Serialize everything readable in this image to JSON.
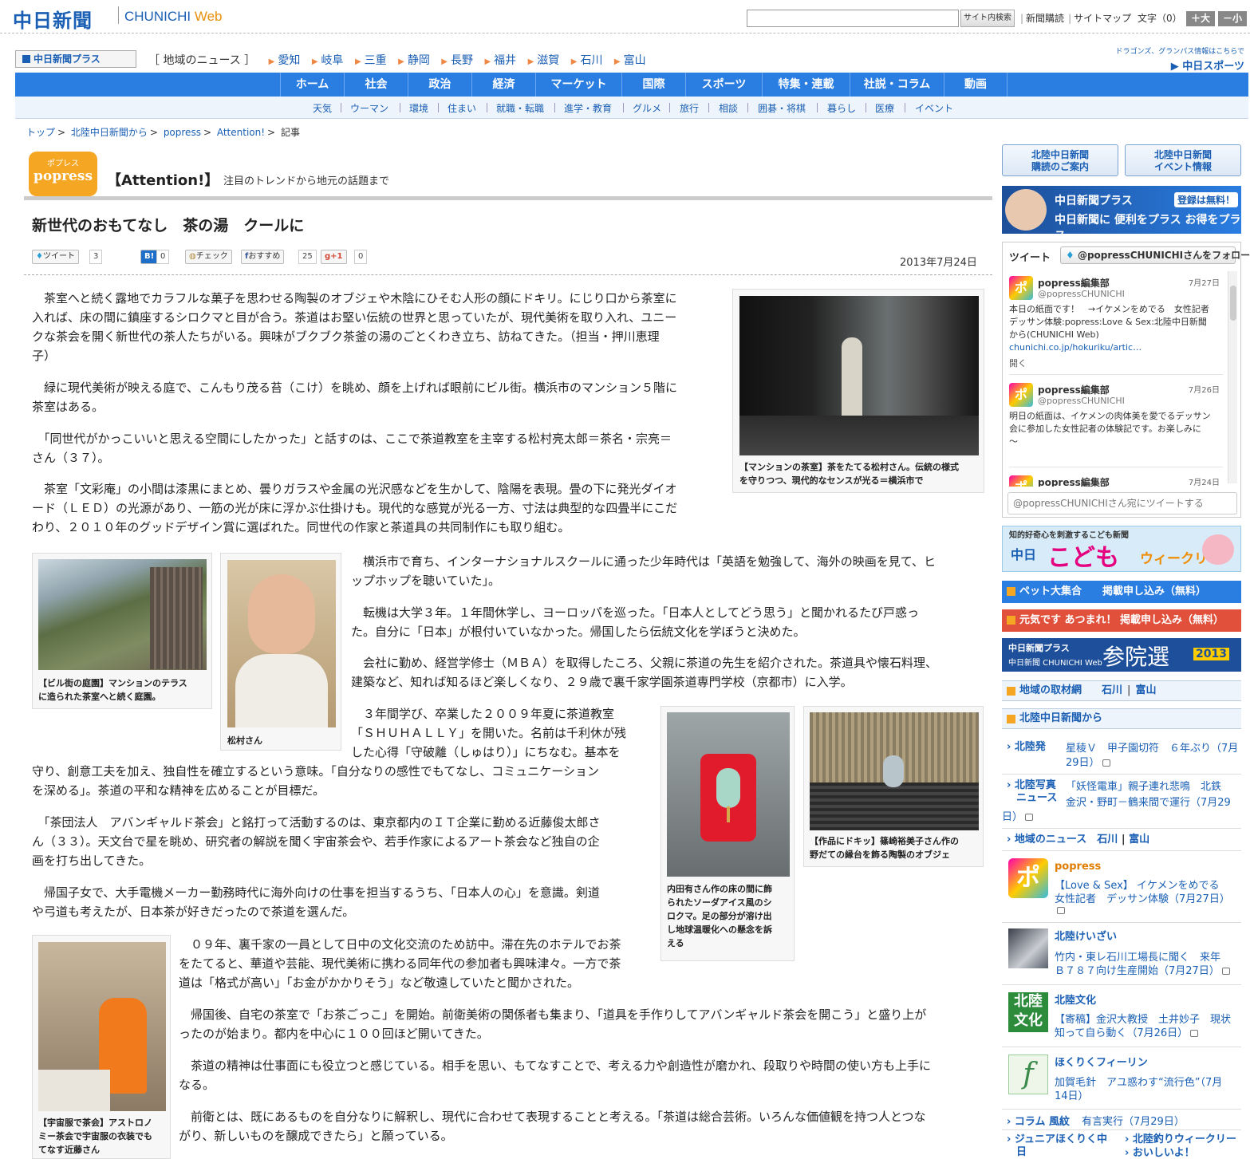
{
  "header": {
    "logo": "中日新聞",
    "logo_sub_a": "CHUNICHI ",
    "logo_sub_b": "Web",
    "search_placeholder": "",
    "search_button": "サイト内検索",
    "link_subscribe": "新聞購読",
    "link_sitemap": "サイトマップ",
    "text_size_label": "文字（0）",
    "size_up": "＋大",
    "size_down": "－小"
  },
  "plus_bar": {
    "logo": "中日新聞プラス",
    "region_label": "［ 地域のニュース ］",
    "regions": [
      "愛知",
      "岐阜",
      "三重",
      "静岡",
      "長野",
      "福井",
      "滋賀",
      "石川",
      "富山"
    ],
    "dragons_note_1": "ドラゴンズ、グランパス情報はこちらで",
    "sports_link": "中日スポーツ"
  },
  "main_nav": [
    "ホーム",
    "社会",
    "政治",
    "経済",
    "マーケット",
    "国際",
    "スポーツ",
    "特集・連載",
    "社説・コラム",
    "動画"
  ],
  "sub_nav": [
    "天気",
    "ウーマン",
    "環境",
    "住まい",
    "就職・転職",
    "進学・教育",
    "グルメ",
    "旅行",
    "相談",
    "囲碁・将棋",
    "暮らし",
    "医療",
    "イベント"
  ],
  "breadcrumb": [
    "トップ",
    "北陸中日新聞から",
    "popress",
    "Attention!",
    "記事"
  ],
  "section": {
    "logo_kana": "ポプレス",
    "logo_name": "popress",
    "title": "【Attention!】",
    "desc": "注目のトレンドから地元の話題まで"
  },
  "article": {
    "title": "新世代のおもてなし　茶の湯　クールに",
    "date": "2013年7月24日",
    "social": {
      "tweet": "ツイート",
      "tweet_count": "3",
      "hatena_count": "0",
      "check": "チェック",
      "fb": "おすすめ",
      "fb_count": "25",
      "gplus": "+1",
      "gplus_count": "0"
    },
    "p1": [
      "　茶室へと続く露地でカラフルな菓子を思わせる陶製のオブジェや木陰にひそむ人形の顔にドキリ。にじり口から茶室に",
      "入れば、床の間に鎮座するシロクマと目が合う。茶道はお堅い伝統の世界と思っていたが、現代美術を取り入れ、ユニー",
      "クな茶会を開く新世代の茶人たちがいる。興味がブクブク茶釜の湯のごとくわき立ち、訪ねてきた。（担当・押川恵理",
      "子）"
    ],
    "p2": [
      "　緑に現代美術が映える庭で、こんもり茂る苔（こけ）を眺め、顔を上げれば眼前にビル街。横浜市のマンション５階に",
      "茶室はある。"
    ],
    "p3": [
      "　「同世代がかっこいいと思える空間にしたかった」と話すのは、ここで茶道教室を主宰する松村亮太郎＝茶名・宗亮＝",
      "さん（３７）。"
    ],
    "p4": [
      "　茶室「文彩庵」の小間は漆黒にまとめ、曇りガラスや金属の光沢感などを生かして、陰陽を表現。畳の下に発光ダイオ",
      "ード（ＬＥＤ）の光源があり、一筋の光が床に浮かぶ仕掛けも。現代的な感覚が光る一方、寸法は典型的な四畳半にこだ",
      "わり、２０１０年のグッドデザイン賞に選ばれた。同世代の作家と茶道具の共同制作にも取り組む。"
    ],
    "p5": [
      "　横浜市で育ち、インターナショナルスクールに通った少年時代は「英語を勉強して、海外の映画を見て、ヒ",
      "ップホップを聴いていた」。"
    ],
    "p6": [
      "　転機は大学３年。１年間休学し、ヨーロッパを巡った。「日本人としてどう思う」と聞かれるたび戸惑っ",
      "た。自分に「日本」が根付いていなかった。帰国したら伝統文化を学ぼうと決めた。"
    ],
    "p7": [
      "　会社に勤め、経営学修士（ＭＢＡ）を取得したころ、父親に茶道の先生を紹介された。茶道具や懐石料理、",
      "建築など、知れば知るほど楽しくなり、２９歳で裏千家学園茶道専門学校（京都市）に入学。"
    ],
    "p8a": [
      "　３年間学び、卒業した２００９年夏に茶道教室",
      "「ＳＨＵＨＡＬＬＹ」を開いた。名前は千利休が残",
      "した心得「守破離（しゅはり）」にちなむ。基本を"
    ],
    "p8b": [
      "守り、創意工夫を加え、独自性を確立するという意味。「自分なりの感性でもてなし、コミュニケーション",
      "を深める」。茶道の平和な精神を広めることが目標だ。"
    ],
    "p9": [
      "　「茶団法人　アバンギャルド茶会」と銘打って活動するのは、東京都内のＩＴ企業に勤める近藤俊太郎さ",
      "ん（３３）。天文台で星を眺め、研究者の解説を聞く宇宙茶会や、若手作家によるアート茶会など独自の企",
      "画を打ち出してきた。"
    ],
    "p10": [
      "　帰国子女で、大手電機メーカー勤務時代に海外向けの仕事を担当するうち、「日本人の心」を意識。剣道",
      "や弓道も考えたが、日本茶が好きだったので茶道を選んだ。"
    ],
    "p11": [
      "　０９年、裏千家の一員として日中の文化交流のため訪中。滞在先のホテルでお茶",
      "をたてると、華道や芸能、現代美術に携わる同年代の参加者も興味津々。一方で茶",
      "道は「格式が高い」「お金がかかりそう」など敬遠していたと聞かされた。"
    ],
    "p12": [
      "　帰国後、自宅の茶室で「お茶ごっこ」を開始。前衛美術の関係者も集まり、「道具を手作りしてアバンギャルド茶会を開こう」と盛り上が",
      "ったのが始まり。都内を中心に１００回ほど開いてきた。"
    ],
    "p13": [
      "　茶道の精神は仕事面にも役立つと感じている。相手を思い、もてなすことで、考える力や創造性が磨かれ、段取りや時間の使い方も上手に",
      "なる。"
    ],
    "p14": [
      "　前衛とは、既にあるものを自分なりに解釈し、現代に合わせて表現することと考える。「茶道は総合芸術。いろんな価値観を持つ人とつな",
      "がり、新しいものを醸成できたら」と願っている。"
    ]
  },
  "photos": {
    "tea_room": [
      "【マンションの茶室】茶をたてる松村さん。伝統の様式",
      "を守りつつ、現代的なセンスが光る＝横浜市で"
    ],
    "garden": [
      "【ビル街の庭園】マンションのテラス",
      "に造られた茶室へと続く庭園。"
    ],
    "matsumura": [
      "松村さん"
    ],
    "bear": [
      "内田有さん作の床の間に飾",
      "られたソーダアイス風のシ",
      "ロクマ。足の部分が溶け出",
      "し地球温暖化への懸念を訴",
      "える"
    ],
    "objet": [
      "【作品にドキッ】篠崎裕美子さん作の",
      "野だての縁台を飾る陶製のオブジェ"
    ],
    "space": [
      "【宇宙服で茶会】アストロノ",
      "ミー茶会で宇宙服の衣装でも",
      "てなす近藤さん"
    ]
  },
  "sidebar": {
    "btn_subscribe": [
      "北陸中日新聞",
      "購読のご案内"
    ],
    "btn_event": [
      "北陸中日新聞",
      "イベント情報"
    ],
    "plus_banner": {
      "t1": "中日新聞プラス",
      "t2": "登録は無料！",
      "t3": "中日新聞に 便利をプラス お得をプラス"
    },
    "twitter": {
      "label": "ツイート",
      "follow": "@popressCHUNICHIさんをフォロー",
      "tweets": [
        {
          "name": "popress編集部",
          "handle": "@popressCHUNICHI",
          "date": "7月27日",
          "text": [
            "本日の紙面です！　→イケメンをめでる　女性記者",
            "デッサン体験:popress:Love & Sex:北陸中日新聞",
            "から(CHUNICHI Web)"
          ],
          "link": "chunichi.co.jp/hokuriku/artic…",
          "extra": "開く"
        },
        {
          "name": "popress編集部",
          "handle": "@popressCHUNICHI",
          "date": "7月26日",
          "text": [
            "明日の紙面は、イケメンの肉体美を愛でるデッサン",
            "会に参加した女性記者の体験記です。お楽しみに",
            "〜"
          ],
          "link": "",
          "extra": ""
        },
        {
          "name": "popress編集部",
          "handle": "",
          "date": "7月24日",
          "text": [],
          "link": "",
          "extra": ""
        }
      ],
      "input_placeholder": "@popressCHUNICHIさん宛にツイートする"
    },
    "kodomo": {
      "t0": "知的好奇心を刺激するこども新聞",
      "t1": "中日",
      "t2": "こども",
      "t3": "ウィークリー"
    },
    "pet_bar": "ペット大集合　　掲載申し込み（無料）",
    "genki_bar": "元気です あつまれ！ 掲載申し込み（無料）",
    "sangi": {
      "s1": "中日新聞プラス",
      "s2": "中日新聞 CHUNICHI Web",
      "s3": "参院選",
      "s4": "2013"
    },
    "chiiki_head": "地域の取材網",
    "chiiki_ishikawa": "石川",
    "chiiki_toyama": "富山",
    "hokuriku_head": "北陸中日新聞から",
    "hokuriku_items": [
      {
        "label": "北陸発",
        "text1": "星稜Ｖ　甲子園切符　６年ぶり（7月",
        "text2": "29日）"
      },
      {
        "label": "北陸写真",
        "label2": "ニュース",
        "text1": "「妖怪電車」親子連れ悲鳴　北鉄",
        "text2": "金沢・野町－鶴来間で運行（7月29",
        "text3": "日）"
      }
    ],
    "local_news_head": "地域のニュース",
    "local_ishikawa": "石川",
    "local_toyama": "富山",
    "popress_item": {
      "title": "popress",
      "line1": "【Love & Sex】 イケメンをめでる",
      "line2": "女性記者　デッサン体験（7月27日）"
    },
    "keizai_item": {
      "title": "北陸けいざい",
      "line1": "竹内・東レ石川工場長に聞く　来年",
      "line2": "Ｂ７８７向け生産開始（7月27日）"
    },
    "bunka_item": {
      "title": "北陸文化",
      "line1": "【寄稿】金沢大教授　土井妙子　現状",
      "line2": "知って自ら動く（7月26日）"
    },
    "feeling_item": {
      "title": "ほくりくフィーリン",
      "line1": "加賀毛針　アユ惑わす“流行色”（7月",
      "line2": "14日）"
    },
    "column_line": {
      "label": "コラム 風紋",
      "text": "有言実行（7月29日）"
    },
    "bottom_left": [
      "ジュニアほくりく中",
      "日"
    ],
    "bottom_right": [
      "北陸釣りウィークリー",
      "おいしいよ！"
    ]
  }
}
